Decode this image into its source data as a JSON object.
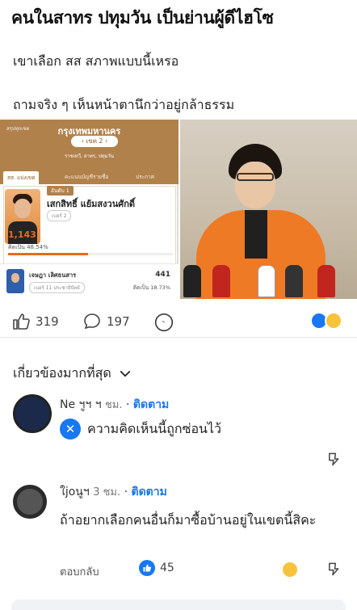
{
  "post": {
    "headline": "คนในสาทร ปทุมวัน เป็นย่านผู้ดีไฮโซ",
    "caption_line1": "เขาเลือก สส สภาพแบบนี้เหรอ",
    "caption_line2": "ถามจริง ๆ เห็นหน้าตานึกว่าอยู่กล้าธรรม"
  },
  "election_card": {
    "small_label": "สรุปทุกเขต",
    "province": "กรุงเทพมหานคร",
    "district": "เขต 2",
    "area": "ราชเทวี, สาทร, ปทุมวัน",
    "tabs": [
      "สส. แบ่งเขต",
      "คะแนนบัญชีรายชื่อ",
      "ประกาศ"
    ],
    "winner": {
      "rank": "อันดับ 1",
      "name": "เสกสิทธิ์ แย้มสงวนศักดิ์",
      "party_no": "เบอร์ 2",
      "votes": "1,143",
      "percent_label": "คิดเป็น 48.54%",
      "percent_value": 48.54
    },
    "runner_up": {
      "name": "เจษฎา เลิศธนสาร",
      "party": "เบอร์ 11  ประชาธิปัตย์",
      "votes": "441",
      "percent_label": "คิดเป็น 18.73%"
    }
  },
  "reactions": {
    "likes": "319",
    "comments": "197"
  },
  "comments_header": "เกี่ยวข้องมากที่สุด",
  "comment1": {
    "name": "Ne  ฯูฯ  ฯ",
    "time": "ชม.",
    "follow": "ติดตาม",
    "hidden_text": "ความคิดเห็นนี้ถูกซ่อนไว้"
  },
  "comment2": {
    "name": "ใjoนูฯ",
    "time": "3 ชม.",
    "follow": "ติดตาม",
    "text": "ถ้าอยากเลือกคนอื่นก็มาซื้อบ้านอยู่ในเขตนี้สิคะ",
    "reply": "ตอบกลับ",
    "likes": "45"
  },
  "colors": {
    "brand": "#1877f2",
    "card_gold": "#b0814b",
    "party_orange": "#e86a1a"
  }
}
